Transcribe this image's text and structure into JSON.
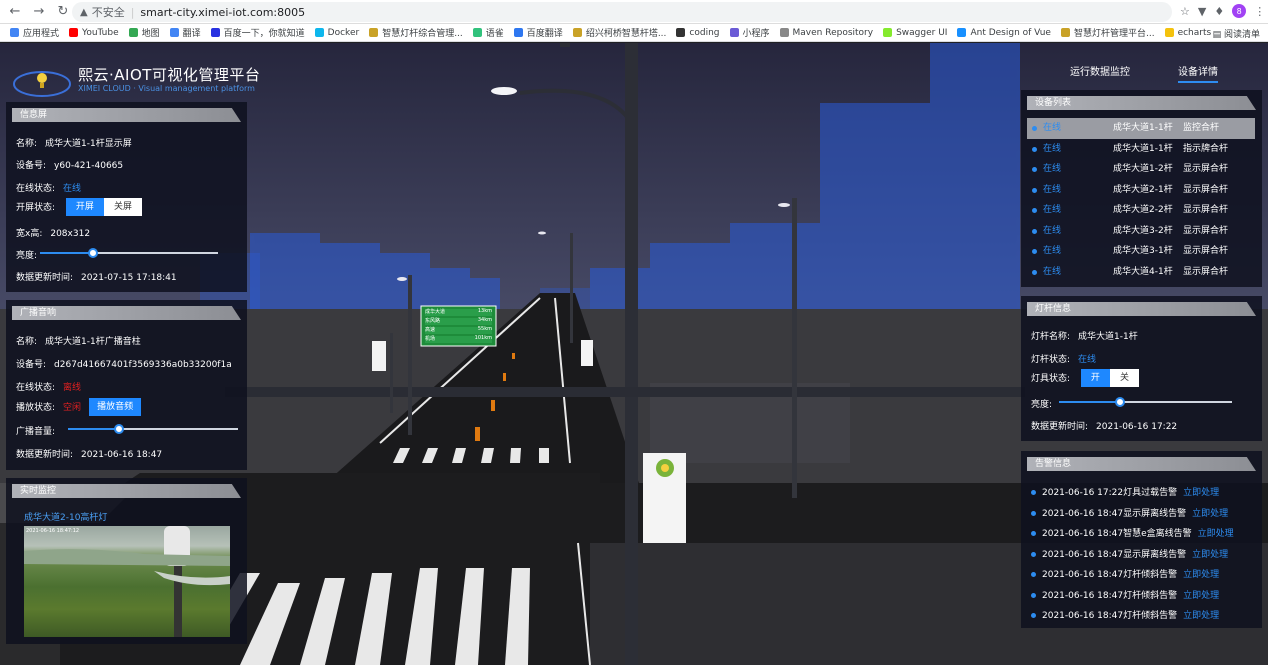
{
  "browser": {
    "insecure_label": "不安全",
    "url": "smart-city.ximei-iot.com:8005",
    "bookmarks": [
      "应用程式",
      "YouTube",
      "地图",
      "翻译",
      "百度一下，你就知道",
      "Docker",
      "智慧灯杆综合管理...",
      "语雀",
      "百度翻译",
      "绍兴柯桥智慧杆塔...",
      "coding",
      "小程序",
      "Maven Repository",
      "Swagger UI",
      "Ant Design of Vue",
      "智慧灯杆管理平台...",
      "echarts"
    ],
    "reading_list": "阅读清单",
    "avatar_letter": "8"
  },
  "header": {
    "title": "熙云·AIOT可视化管理平台",
    "subtitle": "XIMEI CLOUD · Visual management platform",
    "nav": [
      "运行数据监控",
      "设备详情"
    ]
  },
  "screen_panel": {
    "title": "信息屏",
    "name_label": "名称:",
    "name": "成华大道1-1杆显示屏",
    "device_label": "设备号:",
    "device": "y60-421-40665",
    "online_label": "在线状态:",
    "online": "在线",
    "power_label": "开屏状态:",
    "power_on": "开屏",
    "power_off": "关屏",
    "size_label": "宽x高:",
    "size": "208x312",
    "brightness_label": "亮度:",
    "brightness": 0.3,
    "update_label": "数据更新时间:",
    "update": "2021-07-15 17:18:41"
  },
  "broadcast_panel": {
    "title": "广播音响",
    "name_label": "名称:",
    "name": "成华大道1-1杆广播音柱",
    "device_label": "设备号:",
    "device": "d267d41667401f3569336a0b33200f1a",
    "online_label": "在线状态:",
    "online": "离线",
    "play_label": "播放状态:",
    "play": "空闲",
    "play_button": "播放音频",
    "volume_label": "广播音量:",
    "volume": 0.3,
    "update_label": "数据更新时间:",
    "update": "2021-06-16 18:47"
  },
  "monitor_panel": {
    "title": "实时监控",
    "camera_name": "成华大道2-10高杆灯",
    "camera_timestamp": "2021-06-16 18:47:12"
  },
  "device_list": {
    "title": "设备列表",
    "rows": [
      {
        "status": "在线",
        "name": "成华大道1-1杆",
        "type": "监控合杆"
      },
      {
        "status": "在线",
        "name": "成华大道1-1杆",
        "type": "指示牌合杆"
      },
      {
        "status": "在线",
        "name": "成华大道1-2杆",
        "type": "显示屏合杆"
      },
      {
        "status": "在线",
        "name": "成华大道2-1杆",
        "type": "显示屏合杆"
      },
      {
        "status": "在线",
        "name": "成华大道2-2杆",
        "type": "显示屏合杆"
      },
      {
        "status": "在线",
        "name": "成华大道3-2杆",
        "type": "显示屏合杆"
      },
      {
        "status": "在线",
        "name": "成华大道3-1杆",
        "type": "显示屏合杆"
      },
      {
        "status": "在线",
        "name": "成华大道4-1杆",
        "type": "显示屏合杆"
      }
    ]
  },
  "pole_info": {
    "title": "灯杆信息",
    "name_label": "灯杆名称:",
    "name": "成华大道1-1杆",
    "status_label": "灯杆状态:",
    "status": "在线",
    "lamp_label": "灯具状态:",
    "lamp_on": "开",
    "lamp_off": "关",
    "brightness_label": "亮度:",
    "brightness": 0.35,
    "update_label": "数据更新时间:",
    "update": "2021-06-16 17:22"
  },
  "alarm_panel": {
    "title": "告警信息",
    "action": "立即处理",
    "rows": [
      "2021-06-16 17:22灯具过载告警",
      "2021-06-16 18:47显示屏离线告警",
      "2021-06-16 18:47智慧e盒离线告警",
      "2021-06-16 18:47显示屏离线告警",
      "2021-06-16 18:47灯杆倾斜告警",
      "2021-06-16 18:47灯杆倾斜告警",
      "2021-06-16 18:47灯杆倾斜告警"
    ]
  },
  "scene_signs": {
    "rows": [
      {
        "road": "成华大道",
        "dist": "13"
      },
      {
        "road": "东风路",
        "dist": "34"
      },
      {
        "road": "高速",
        "dist": "55"
      },
      {
        "road": "机场",
        "dist": "101"
      }
    ],
    "unit": "km"
  },
  "colors": {
    "accent": "#2d8cf0",
    "offline": "#e02020",
    "panel_bg": "#0e101e",
    "building_blue": "#2a5bd8"
  }
}
